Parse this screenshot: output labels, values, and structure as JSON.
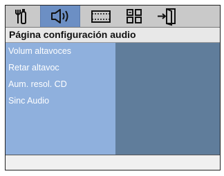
{
  "toolbar": {
    "icons": [
      {
        "name": "settings-wrench-icon",
        "selected": false
      },
      {
        "name": "speaker-audio-icon",
        "selected": true
      },
      {
        "name": "film-video-icon",
        "selected": false
      },
      {
        "name": "preferences-grid-icon",
        "selected": false
      },
      {
        "name": "exit-door-icon",
        "selected": false
      }
    ]
  },
  "page": {
    "title": "Página configuración audio"
  },
  "menu": {
    "items": [
      {
        "label": "Volum altavoces"
      },
      {
        "label": "Retar altavoc"
      },
      {
        "label": "Aum. resol. CD"
      },
      {
        "label": "Sinc Audio"
      }
    ]
  },
  "colors": {
    "selected_tab": "#6c8fc4",
    "menu_panel": "#8fb0dd",
    "detail_panel": "#607d9b"
  }
}
